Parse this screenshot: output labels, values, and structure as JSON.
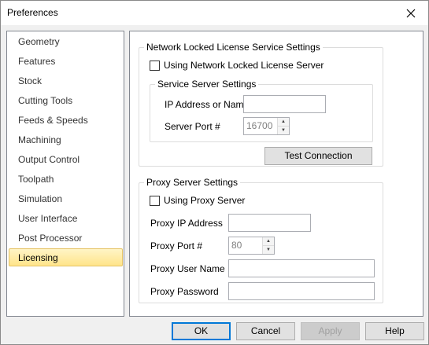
{
  "window": {
    "title": "Preferences"
  },
  "sidebar": {
    "items": [
      {
        "label": "Geometry"
      },
      {
        "label": "Features"
      },
      {
        "label": "Stock"
      },
      {
        "label": "Cutting Tools"
      },
      {
        "label": "Feeds & Speeds"
      },
      {
        "label": "Machining"
      },
      {
        "label": "Output Control"
      },
      {
        "label": "Toolpath"
      },
      {
        "label": "Simulation"
      },
      {
        "label": "User Interface"
      },
      {
        "label": "Post Processor"
      },
      {
        "label": "Licensing"
      }
    ],
    "selected": "Licensing"
  },
  "network": {
    "group_title": "Network Locked License Service Settings",
    "use_server_label": "Using Network Locked License Server",
    "use_server_checked": false,
    "service": {
      "group_title": "Service Server Settings",
      "ip_label": "IP Address or Name",
      "ip_value": "",
      "port_label": "Server Port #",
      "port_value": "16700"
    },
    "test_button": "Test Connection"
  },
  "proxy": {
    "group_title": "Proxy Server Settings",
    "use_proxy_label": "Using Proxy Server",
    "use_proxy_checked": false,
    "ip_label": "Proxy IP Address",
    "ip_value": "",
    "port_label": "Proxy Port #",
    "port_value": "80",
    "user_label": "Proxy User Name",
    "user_value": "",
    "password_label": "Proxy Password",
    "password_value": ""
  },
  "buttons": {
    "ok": "OK",
    "cancel": "Cancel",
    "apply": "Apply",
    "help": "Help"
  }
}
